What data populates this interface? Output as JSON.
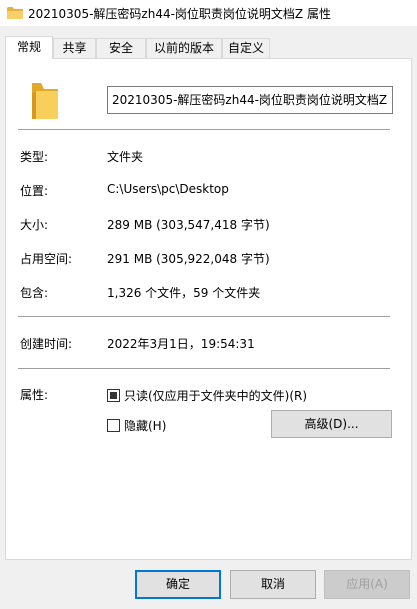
{
  "window": {
    "title": "20210305-解压密码zh44-岗位职责岗位说明文档Z 属性"
  },
  "tabs": [
    {
      "label": "常规",
      "active": true
    },
    {
      "label": "共享",
      "active": false
    },
    {
      "label": "安全",
      "active": false
    },
    {
      "label": "以前的版本",
      "active": false
    },
    {
      "label": "自定义",
      "active": false
    }
  ],
  "general": {
    "name_value": "20210305-解压密码zh44-岗位职责岗位说明文档Z",
    "type": {
      "label": "类型:",
      "value": "文件夹"
    },
    "location": {
      "label": "位置:",
      "value": "C:\\Users\\pc\\Desktop"
    },
    "size": {
      "label": "大小:",
      "value": "289 MB (303,547,418 字节)"
    },
    "size_on_disk": {
      "label": "占用空间:",
      "value": "291 MB (305,922,048 字节)"
    },
    "contains": {
      "label": "包含:",
      "value": "1,326 个文件，59 个文件夹"
    },
    "created": {
      "label": "创建时间:",
      "value": "2022年3月1日，19:54:31"
    },
    "attributes": {
      "label": "属性:",
      "readonly_label": "只读(仅应用于文件夹中的文件)(R)",
      "hidden_label": "隐藏(H)",
      "advanced_label": "高级(D)..."
    }
  },
  "buttons": {
    "ok": "确定",
    "cancel": "取消",
    "apply": "应用(A)"
  },
  "colors": {
    "folder": "#f5c342",
    "accent": "#0078d7"
  }
}
